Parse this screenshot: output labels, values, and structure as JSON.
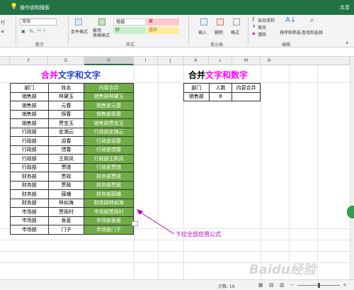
{
  "topbar": {
    "search": "操作说明搜索",
    "share": "共享"
  },
  "ribbon": {
    "font_name": "微软雅",
    "number_format": "常规",
    "group_number": "数字",
    "group_styles": "样式",
    "group_cells": "单元格",
    "group_editing": "编辑",
    "conditional_format": "条件格式",
    "table_format": "套用\n表格格式",
    "style_normal": "常规",
    "style_bad": "差",
    "style_good": "好",
    "style_neutral": "适中",
    "insert": "插入",
    "delete": "删除",
    "format": "格式",
    "autosum": "自动求和",
    "fill": "填充",
    "clear": "清除",
    "sort_filter": "排序和筛选",
    "find_select": "查找和选择",
    "line_label": "行"
  },
  "columns": [
    "F",
    "G",
    "H",
    "I",
    "J",
    "K",
    "L",
    "M",
    "N"
  ],
  "left_title": {
    "part1": "合并",
    "part2": "文字和文字"
  },
  "right_title": {
    "part1": "合并",
    "part2": "文字和数字"
  },
  "left_table": {
    "headers": [
      "部门",
      "姓名",
      "内容合并"
    ],
    "rows": [
      [
        "销售部",
        "林黛玉",
        "销售部林黛玉"
      ],
      [
        "销售部",
        "元春",
        "销售部元春"
      ],
      [
        "销售部",
        "探春",
        "销售部探春"
      ],
      [
        "销售部",
        "贾宝玉",
        "销售部贾宝玉"
      ],
      [
        "行政部",
        "史湘云",
        "行政部史湘云"
      ],
      [
        "行政部",
        "迎春",
        "行政部迎春"
      ],
      [
        "行政部",
        "惜春",
        "行政部惜春"
      ],
      [
        "行政部",
        "王熙凤",
        "行政部王熙凤"
      ],
      [
        "行政部",
        "贾琏",
        "行政部贾琏"
      ],
      [
        "财务部",
        "贾政",
        "财务部贾政"
      ],
      [
        "财务部",
        "贾赦",
        "财务部贾赦"
      ],
      [
        "财务部",
        "薛蟠",
        "财务部薛蟠"
      ],
      [
        "财务部",
        "林如海",
        "财务部林如海"
      ],
      [
        "市场部",
        "贾雨村",
        "市场部贾雨村"
      ],
      [
        "市场部",
        "香菱",
        "市场部香菱"
      ],
      [
        "市场部",
        "门子",
        "市场部门子"
      ]
    ]
  },
  "right_table": {
    "headers": [
      "部门",
      "人数",
      "内容合并"
    ],
    "rows": [
      [
        "销售部",
        "8",
        ""
      ]
    ]
  },
  "annotation": "下拉全部应用公式",
  "status": {
    "count": "计数: 16"
  },
  "watermark": "Baidu经验",
  "colors": {
    "excel_green": "#217346",
    "cell_green": "#70ad47",
    "title_red": "#ff00ff",
    "title_blue": "#1f3fcf",
    "title_magenta": "#ff00ff"
  }
}
